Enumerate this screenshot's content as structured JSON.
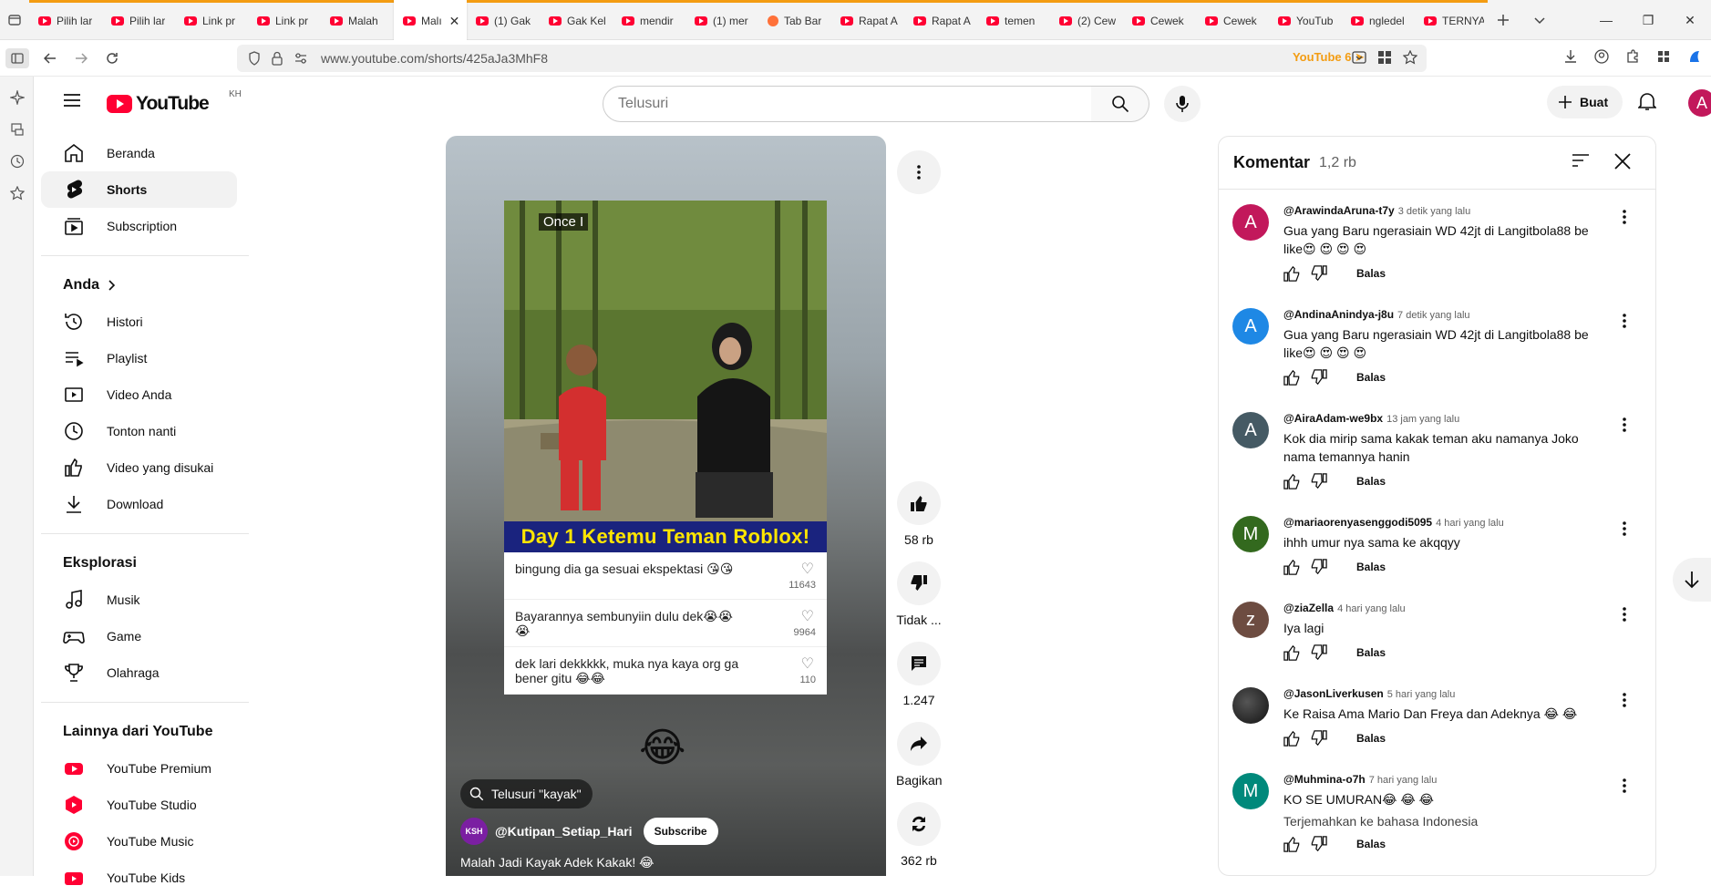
{
  "browser": {
    "tabs": [
      {
        "label": "Pilih lar",
        "favicon": "youtube-icon"
      },
      {
        "label": "Pilih lar",
        "favicon": "youtube-icon"
      },
      {
        "label": "Link pr",
        "favicon": "youtube-icon"
      },
      {
        "label": "Link pr",
        "favicon": "youtube-icon"
      },
      {
        "label": "Malah",
        "favicon": "youtube-icon"
      },
      {
        "label": "Malı",
        "favicon": "youtube-icon",
        "active": true
      },
      {
        "label": "(1) Gak",
        "favicon": "youtube-icon"
      },
      {
        "label": "Gak Kel",
        "favicon": "youtube-icon"
      },
      {
        "label": "mendir",
        "favicon": "youtube-icon"
      },
      {
        "label": "(1) mer",
        "favicon": "youtube-icon"
      },
      {
        "label": "Tab Bar",
        "favicon": "firefox-icon"
      },
      {
        "label": "Rapat A",
        "favicon": "youtube-icon"
      },
      {
        "label": "Rapat A",
        "favicon": "youtube-icon"
      },
      {
        "label": "temen",
        "favicon": "youtube-icon"
      },
      {
        "label": "(2) Cew",
        "favicon": "youtube-icon"
      },
      {
        "label": "Cewek",
        "favicon": "youtube-icon"
      },
      {
        "label": "Cewek",
        "favicon": "youtube-icon"
      },
      {
        "label": "YouTub",
        "favicon": "youtube-icon"
      },
      {
        "label": "ngledel",
        "favicon": "youtube-icon"
      },
      {
        "label": "TERNYA",
        "favicon": "youtube-icon"
      }
    ],
    "url": "www.youtube.com/shorts/425aJa3MhF8",
    "extension_label": "YouTube 6"
  },
  "youtube": {
    "country_code": "KH",
    "search_placeholder": "Telusuri",
    "create_label": "Buat",
    "avatar_letter": "A",
    "guide": {
      "main": [
        {
          "label": "Beranda",
          "icon": "home-icon"
        },
        {
          "label": "Shorts",
          "icon": "shorts-icon",
          "active": true
        },
        {
          "label": "Subscription",
          "icon": "subscriptions-icon"
        }
      ],
      "you_header": "Anda",
      "you": [
        {
          "label": "Histori",
          "icon": "history-icon"
        },
        {
          "label": "Playlist",
          "icon": "playlist-icon"
        },
        {
          "label": "Video Anda",
          "icon": "your-videos-icon"
        },
        {
          "label": "Tonton nanti",
          "icon": "watch-later-icon"
        },
        {
          "label": "Video yang disukai",
          "icon": "liked-icon"
        },
        {
          "label": "Download",
          "icon": "download-icon"
        }
      ],
      "explore_header": "Eksplorasi",
      "explore": [
        {
          "label": "Musik",
          "icon": "music-icon"
        },
        {
          "label": "Game",
          "icon": "gaming-icon"
        },
        {
          "label": "Olahraga",
          "icon": "trophy-icon"
        }
      ],
      "more_header": "Lainnya dari YouTube",
      "more": [
        {
          "label": "YouTube Premium",
          "icon": "yt-premium-icon"
        },
        {
          "label": "YouTube Studio",
          "icon": "yt-studio-icon"
        },
        {
          "label": "YouTube Music",
          "icon": "yt-music-icon"
        },
        {
          "label": "YouTube Kids",
          "icon": "yt-kids-icon"
        }
      ]
    },
    "short": {
      "overlay_caption": "Once I",
      "banner": "Day 1 Ketemu Teman Roblox!",
      "overlay_comments": [
        {
          "text": "bingung dia ga sesuai ekspektasi 😘😘",
          "count": "11643"
        },
        {
          "text": "Bayarannya sembunyiin dulu dek😭😭😭",
          "count": "9964"
        },
        {
          "text": "dek lari dekkkkk, muka nya kaya org ga bener gitu 😂😂",
          "count": "110"
        }
      ],
      "emoji": "😂",
      "search_chip": "Telusuri \"kayak\"",
      "channel_initials": "KSH",
      "channel": "@Kutipan_Setiap_Hari",
      "subscribe": "Subscribe",
      "title": "Malah Jadi Kayak Adek Kakak! 😂",
      "actions": {
        "likes": "58 rb",
        "dislike": "Tidak ...",
        "comments": "1.247",
        "share": "Bagikan",
        "remix": "362 rb"
      }
    },
    "comments_panel": {
      "title": "Komentar",
      "count": "1,2 rb",
      "reply_label": "Balas",
      "comments": [
        {
          "initial": "A",
          "color": "#c2185b",
          "author": "@ArawindaAruna-t7y",
          "time": "3 detik yang lalu",
          "text": "Gua yang Baru ngerasiain WD 42jt di Langitbola88 be like😍 😍 😍 😍"
        },
        {
          "initial": "A",
          "color": "#1e88e5",
          "author": "@AndinaAnindya-j8u",
          "time": "7 detik yang lalu",
          "text": "Gua yang Baru ngerasiain WD 42jt di Langitbola88 be like😍 😍 😍 😍"
        },
        {
          "initial": "A",
          "color": "#455a64",
          "author": "@AiraAdam-we9bx",
          "time": "13 jam yang lalu",
          "text": "Kok dia mirip sama kakak teman aku namanya Joko nama temannya hanin"
        },
        {
          "initial": "M",
          "color": "#33691e",
          "author": "@mariaorenyasenggodi5095",
          "time": "4 hari yang lalu",
          "text": "ihhh umur nya sama ke akqqyy"
        },
        {
          "initial": "z",
          "color": "#6d4c41",
          "author": "@ziaZella",
          "time": "4 hari yang lalu",
          "text": "Iya lagi"
        },
        {
          "initial": "",
          "color": "#222222",
          "author": "@JasonLiverkusen",
          "time": "5 hari yang lalu",
          "text": "Ke Raisa Ama Mario Dan Freya dan Adeknya 😂 😂"
        },
        {
          "initial": "M",
          "color": "#00897b",
          "author": "@Muhmina-o7h",
          "time": "7 hari yang lalu",
          "text": "KO SE UMURAN😂 😂 😂",
          "translate": "Terjemahkan ke bahasa Indonesia"
        }
      ]
    }
  }
}
